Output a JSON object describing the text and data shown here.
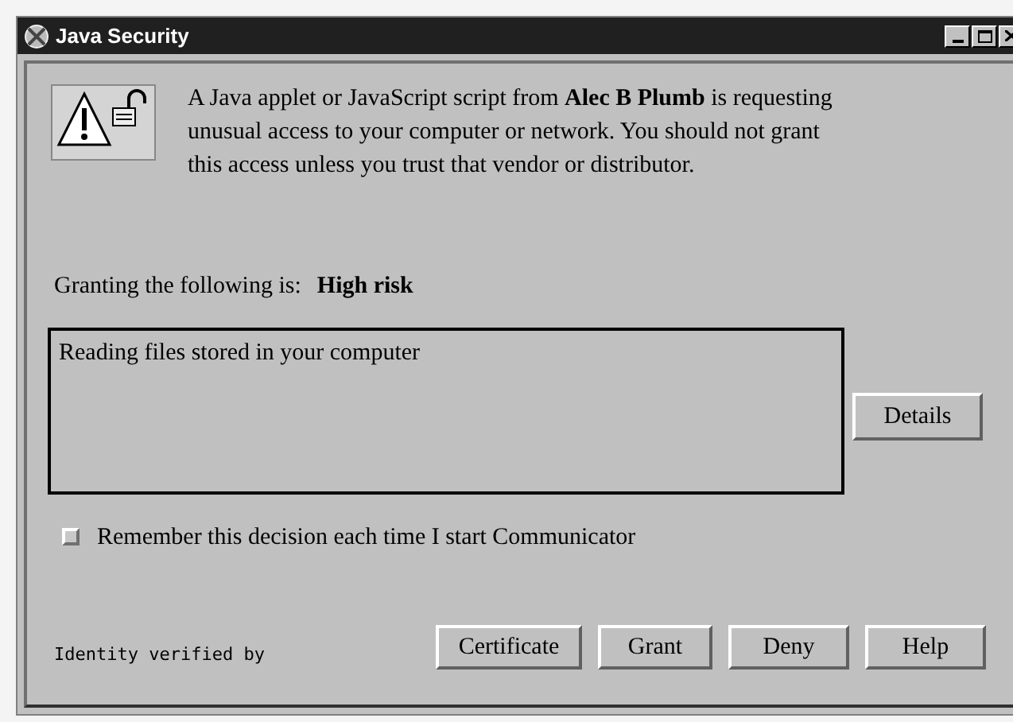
{
  "window": {
    "title": "Java Security"
  },
  "message": "A Java applet or JavaScript script from  **Alec B Plumb**  is requesting unusual access to your computer or network. You should not grant this access unless you trust that vendor or distributor.",
  "risk": {
    "label": "Granting the following is:",
    "level": "High risk"
  },
  "access_list": [
    "Reading files stored in your computer"
  ],
  "details_button": "Details",
  "remember": {
    "label": "Remember this decision each time I start Communicator",
    "checked": false
  },
  "identity": "Identity verified by",
  "buttons": [
    "Certificate",
    "Grant",
    "Deny",
    "Help"
  ]
}
